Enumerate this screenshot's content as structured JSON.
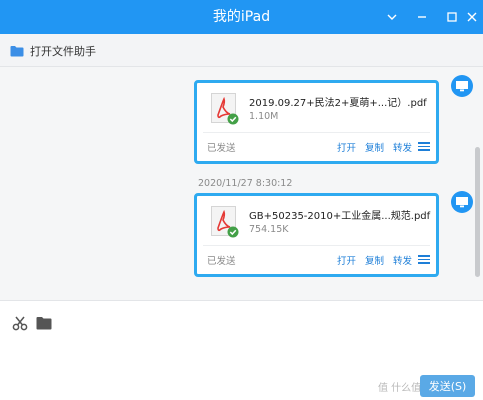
{
  "window": {
    "title": "我的iPad"
  },
  "toolbar": {
    "helper_label": "打开文件助手"
  },
  "messages": [
    {
      "file_name": "2019.09.27+民法2+夏萌+...记）.pdf",
      "file_size": "1.10M",
      "status": "已发送",
      "actions": [
        "打开",
        "复制",
        "转发"
      ]
    },
    {
      "file_name": "GB+50235-2010+工业金属...规范.pdf",
      "file_size": "754.15K",
      "status": "已发送",
      "actions": [
        "打开",
        "复制",
        "转发"
      ]
    }
  ],
  "timestamp": "2020/11/27 8:30:12",
  "composer": {
    "send_label": "发送(S)",
    "watermark": "值 什么值得买"
  },
  "colors": {
    "titlebar": "#2196f3",
    "bubble_border": "#2eaaf0",
    "action_link": "#1e7fd8",
    "pdf_red": "#e53935",
    "check_green": "#43a047"
  }
}
